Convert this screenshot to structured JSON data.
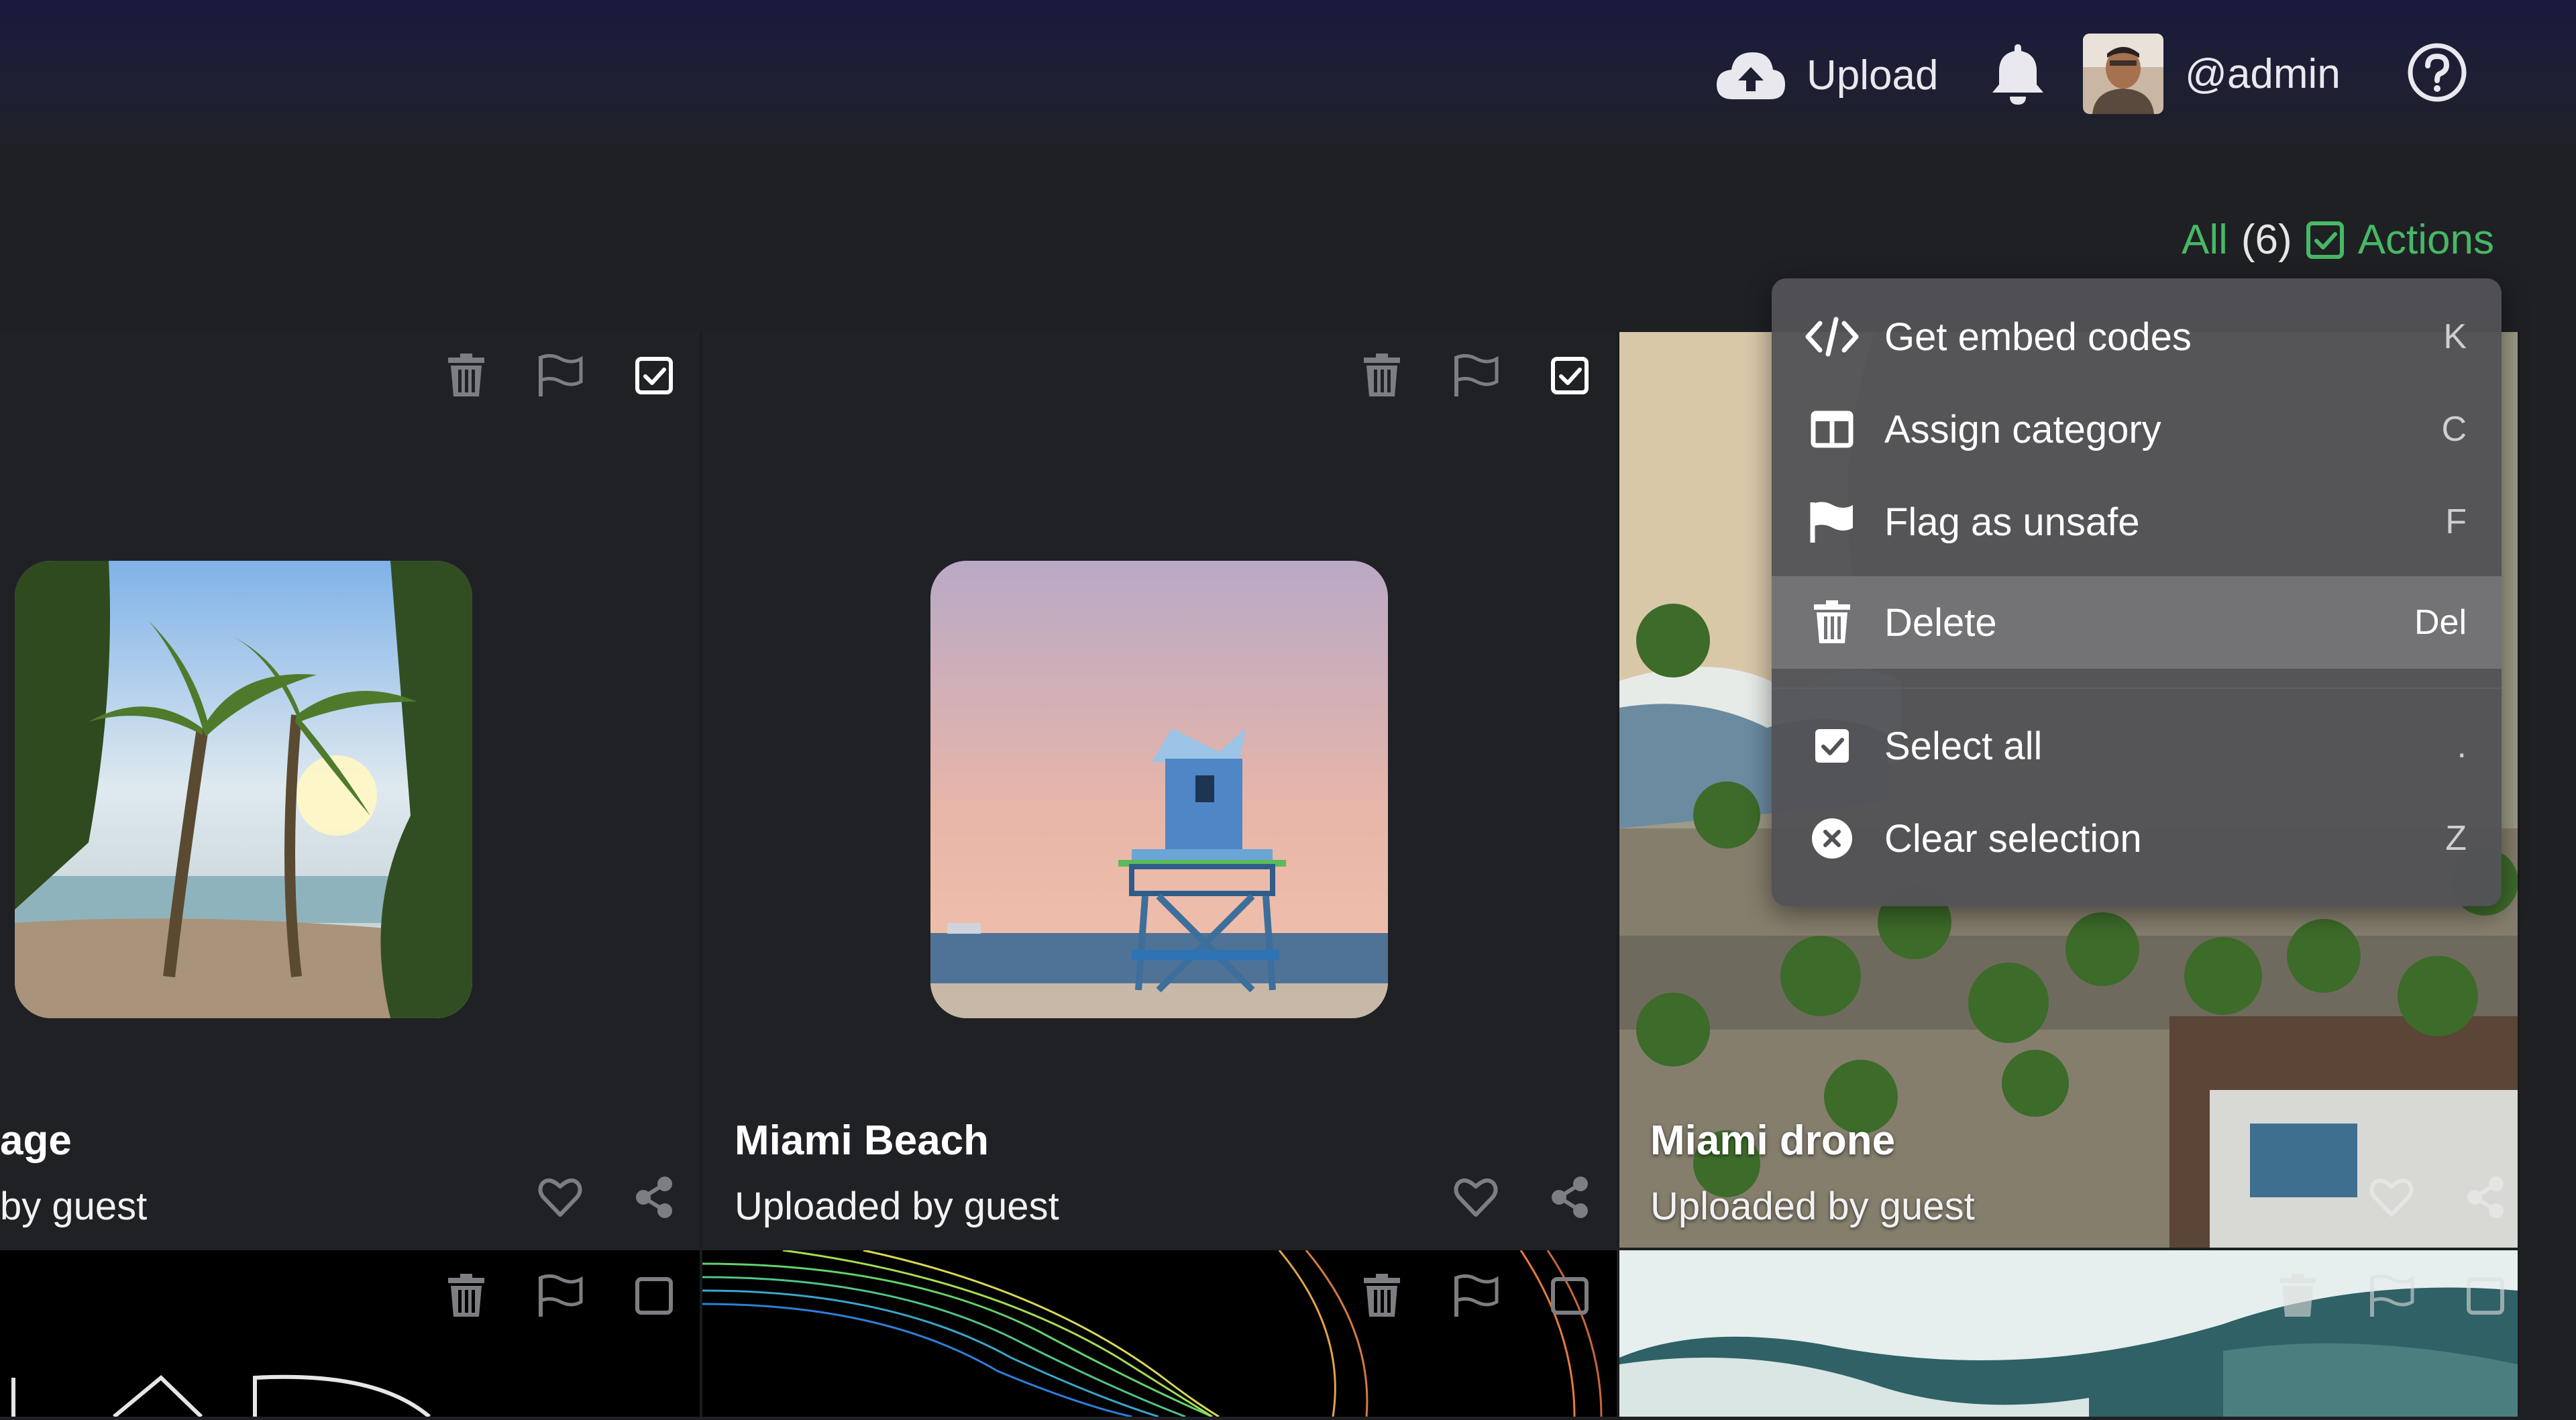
{
  "header": {
    "upload_label": "Upload",
    "username": "@admin",
    "icons": [
      "cloud-upload-icon",
      "bell-icon",
      "help-icon"
    ]
  },
  "filter": {
    "all_label": "All",
    "count": "(6)",
    "actions_label": "Actions"
  },
  "cards": [
    {
      "title": "age",
      "subtitle": "by guest",
      "selected": true
    },
    {
      "title": "Miami Beach",
      "subtitle": "Uploaded by guest",
      "selected": true
    },
    {
      "title": "Miami drone",
      "subtitle": "Uploaded by guest",
      "selected": true
    }
  ],
  "bottom_row_selected": [
    false,
    false,
    false
  ],
  "actions_menu": {
    "items": [
      {
        "label": "Get embed codes",
        "key": "K",
        "icon": "code-icon"
      },
      {
        "label": "Assign category",
        "key": "C",
        "icon": "category-icon"
      },
      {
        "label": "Flag as unsafe",
        "key": "F",
        "icon": "flag-icon"
      },
      {
        "label": "Delete",
        "key": "Del",
        "icon": "trash-icon",
        "highlighted": true
      },
      {
        "label": "Select all",
        "key": ".",
        "icon": "checkbox-icon"
      },
      {
        "label": "Clear selection",
        "key": "Z",
        "icon": "close-circle-icon"
      }
    ]
  },
  "colors": {
    "accent": "#47b866",
    "background": "#1f2024",
    "menu": "#525256"
  }
}
